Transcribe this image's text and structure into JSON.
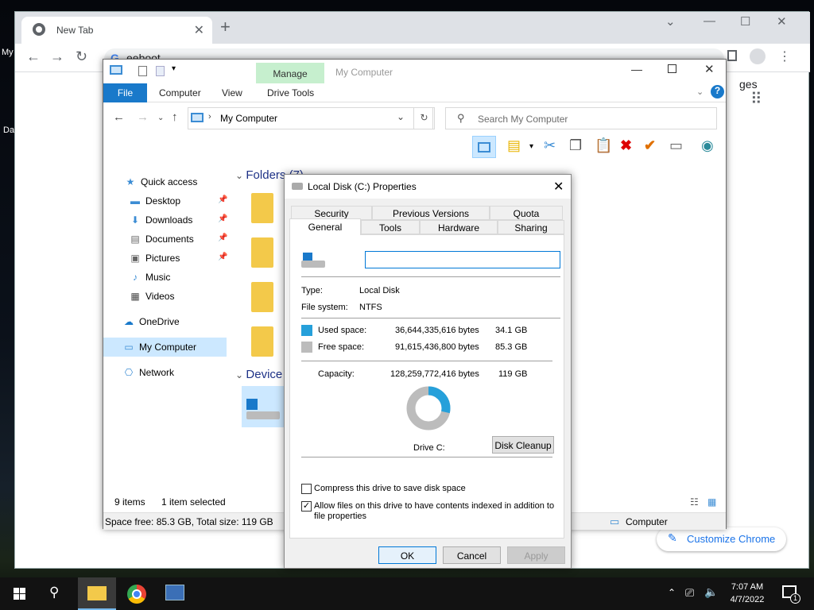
{
  "desktop": {
    "icon1_label": "My",
    "icon2_label": "Da"
  },
  "chrome": {
    "tab_title": "New Tab",
    "tab_close": "✕",
    "new_tab": "+",
    "window_controls": [
      "⌄",
      "—",
      "☐",
      "✕"
    ],
    "omnibox_text": "eeboot",
    "images_link": "ges",
    "customize_label": "Customize Chrome"
  },
  "explorer": {
    "title": "My Computer",
    "manage_tab": "Manage",
    "ribbon_tabs": {
      "file": "File",
      "computer": "Computer",
      "view": "View",
      "drive_tools": "Drive Tools"
    },
    "address": "My Computer",
    "search_placeholder": "Search My Computer",
    "nav": {
      "quick_access": "Quick access",
      "desktop": "Desktop",
      "downloads": "Downloads",
      "documents": "Documents",
      "pictures": "Pictures",
      "music": "Music",
      "videos": "Videos",
      "onedrive": "OneDrive",
      "my_computer": "My Computer",
      "network": "Network"
    },
    "folders_header": "Folders (7)",
    "devices_header": "Device",
    "status_items": "9 items",
    "status_selected": "1 item selected",
    "space_info": "Space free: 85.3 GB, Total size: 119 GB",
    "status_computer": "Computer"
  },
  "dialog": {
    "title": "Local Disk (C:) Properties",
    "tabs_back": [
      "Security",
      "Previous Versions",
      "Quota"
    ],
    "tabs_front": [
      "General",
      "Tools",
      "Hardware",
      "Sharing"
    ],
    "active_tab": "General",
    "name_value": "",
    "type_label": "Type:",
    "type_value": "Local Disk",
    "fs_label": "File system:",
    "fs_value": "NTFS",
    "used_label": "Used space:",
    "used_bytes": "36,644,335,616 bytes",
    "used_gb": "34.1 GB",
    "free_label": "Free space:",
    "free_bytes": "91,615,436,800 bytes",
    "free_gb": "85.3 GB",
    "capacity_label": "Capacity:",
    "capacity_bytes": "128,259,772,416 bytes",
    "capacity_gb": "119 GB",
    "drive_label": "Drive C:",
    "cleanup_button": "Disk Cleanup",
    "compress_label": "Compress this drive to save disk space",
    "compress_checked": false,
    "index_label_1": "Allow files on this drive to have contents indexed in addition to",
    "index_label_2": "file properties",
    "index_checked": true,
    "ok": "OK",
    "cancel": "Cancel",
    "apply": "Apply",
    "used_fraction": 0.2857,
    "colors": {
      "used": "#26a0da",
      "free": "#bcbcbc"
    }
  },
  "taskbar": {
    "time": "7:07 AM",
    "date": "4/7/2022",
    "notification_count": "1"
  }
}
